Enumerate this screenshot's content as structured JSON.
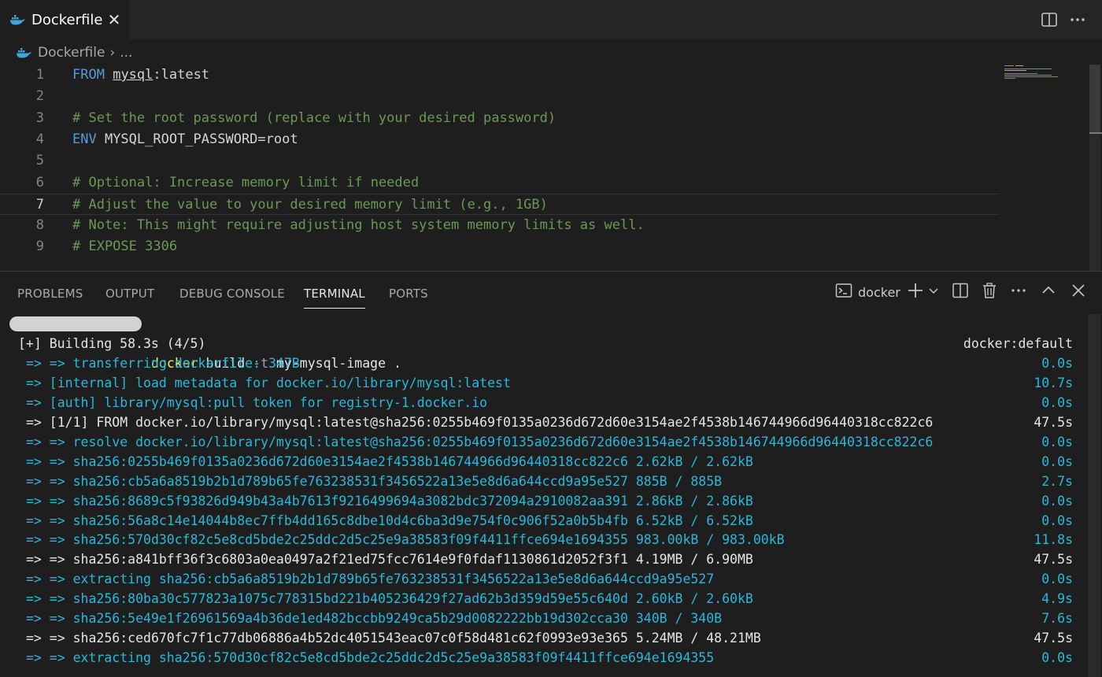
{
  "tab": {
    "label": "Dockerfile",
    "close": "✕"
  },
  "breadcrumb": {
    "file": "Dockerfile",
    "sep": "›",
    "more": "..."
  },
  "editor": {
    "lines": [
      {
        "n": "1",
        "parts": [
          {
            "t": "FROM",
            "c": "kw"
          },
          {
            "t": " ",
            "c": "plain"
          },
          {
            "t": "mysql",
            "c": "img"
          },
          {
            "t": ":latest",
            "c": "plain"
          }
        ]
      },
      {
        "n": "2",
        "parts": []
      },
      {
        "n": "3",
        "parts": [
          {
            "t": "# Set the root password (replace with your desired password)",
            "c": "cm"
          }
        ]
      },
      {
        "n": "4",
        "parts": [
          {
            "t": "ENV",
            "c": "kw"
          },
          {
            "t": " MYSQL_ROOT_PASSWORD=root",
            "c": "plain"
          }
        ]
      },
      {
        "n": "5",
        "parts": []
      },
      {
        "n": "6",
        "parts": [
          {
            "t": "# Optional: Increase memory limit if needed",
            "c": "cm"
          }
        ]
      },
      {
        "n": "7",
        "parts": [
          {
            "t": "# Adjust the value to your desired memory limit (e.g., 1GB)",
            "c": "cm"
          }
        ],
        "current": true
      },
      {
        "n": "8",
        "parts": [
          {
            "t": "# Note: This might require adjusting host system memory limits as well.",
            "c": "cm"
          }
        ]
      },
      {
        "n": "9",
        "parts": [
          {
            "t": "# EXPOSE 3306",
            "c": "cm"
          }
        ]
      }
    ]
  },
  "panel": {
    "tabs": [
      {
        "label": "PROBLEMS",
        "name": "tab-problems"
      },
      {
        "label": "OUTPUT",
        "name": "tab-output"
      },
      {
        "label": "DEBUG CONSOLE",
        "name": "tab-debug-console"
      },
      {
        "label": "TERMINAL",
        "name": "tab-terminal",
        "active": true
      },
      {
        "label": "PORTS",
        "name": "tab-ports"
      }
    ],
    "terminal_name": "docker"
  },
  "terminal": {
    "prompt_command": "docker",
    "prompt_flag": "-t",
    "prompt_rest": " my-mysql-image .",
    "prompt_build": " build ",
    "lines": [
      {
        "left": "[+] Building 58.3s (4/5)",
        "right": "docker:default",
        "color": "white",
        "indent": false
      },
      {
        "left": "=> => transferring dockerfile: 347B",
        "right": "0.0s",
        "color": "blue"
      },
      {
        "left": "=> [internal] load metadata for docker.io/library/mysql:latest",
        "right": "10.7s",
        "color": "blue"
      },
      {
        "left": "=> [auth] library/mysql:pull token for registry-1.docker.io",
        "right": "0.0s",
        "color": "blue"
      },
      {
        "left": "=> [1/1] FROM docker.io/library/mysql:latest@sha256:0255b469f0135a0236d672d60e3154ae2f4538b146744966d96440318cc822c6",
        "right": "47.5s",
        "color": "white"
      },
      {
        "left": "=> => resolve docker.io/library/mysql:latest@sha256:0255b469f0135a0236d672d60e3154ae2f4538b146744966d96440318cc822c6",
        "right": "0.0s",
        "color": "blue"
      },
      {
        "left": "=> => sha256:0255b469f0135a0236d672d60e3154ae2f4538b146744966d96440318cc822c6 2.62kB / 2.62kB",
        "right": "0.0s",
        "color": "blue"
      },
      {
        "left": "=> => sha256:cb5a6a8519b2b1d789b65fe763238531f3456522a13e5e8d6a644ccd9a95e527 885B / 885B",
        "right": "2.7s",
        "color": "blue"
      },
      {
        "left": "=> => sha256:8689c5f93826d949b43a4b7613f9216499694a3082bdc372094a2910082aa391 2.86kB / 2.86kB",
        "right": "0.0s",
        "color": "blue"
      },
      {
        "left": "=> => sha256:56a8c14e14044b8ec7ffb4dd165c8dbe10d4c6ba3d9e754f0c906f52a0b5b4fb 6.52kB / 6.52kB",
        "right": "0.0s",
        "color": "blue"
      },
      {
        "left": "=> => sha256:570d30cf82c5e8cd5bde2c25ddc2d5c25e9a38583f09f4411ffce694e1694355 983.00kB / 983.00kB",
        "right": "11.8s",
        "color": "blue"
      },
      {
        "left": "=> => sha256:a841bff36f3c6803a0ea0497a2f21ed75fcc7614e9f0fdaf1130861d2052f3f1 4.19MB / 6.90MB",
        "right": "47.5s",
        "color": "white"
      },
      {
        "left": "=> => extracting sha256:cb5a6a8519b2b1d789b65fe763238531f3456522a13e5e8d6a644ccd9a95e527",
        "right": "0.0s",
        "color": "blue"
      },
      {
        "left": "=> => sha256:80ba30c577823a1075c778315bd221b405236429f27ad62b3d359d59e55c640d 2.60kB / 2.60kB",
        "right": "4.9s",
        "color": "blue"
      },
      {
        "left": "=> => sha256:5e49e1f26961569a4b36de1ed482bccbb9249ca5b29d0082222bb19d302cca30 340B / 340B",
        "right": "7.6s",
        "color": "blue"
      },
      {
        "left": "=> => sha256:ced670fc7f1c77db06886a4b52dc4051543eac07c0f58d481c62f0993e93e365 5.24MB / 48.21MB",
        "right": "47.5s",
        "color": "white"
      },
      {
        "left": "=> => extracting sha256:570d30cf82c5e8cd5bde2c25ddc2d5c25e9a38583f09f4411ffce694e1694355",
        "right": "0.0s",
        "color": "blue"
      }
    ]
  },
  "icons": {
    "split": "split-editor-icon",
    "more": "more-actions-icon",
    "new_terminal": "+",
    "dropdown": "chevron-down-icon"
  },
  "colors": {
    "keyword": "#569cd6",
    "comment": "#6a9955",
    "terminal_blue": "#29b8db",
    "prompt_yellow": "#f5f543"
  }
}
